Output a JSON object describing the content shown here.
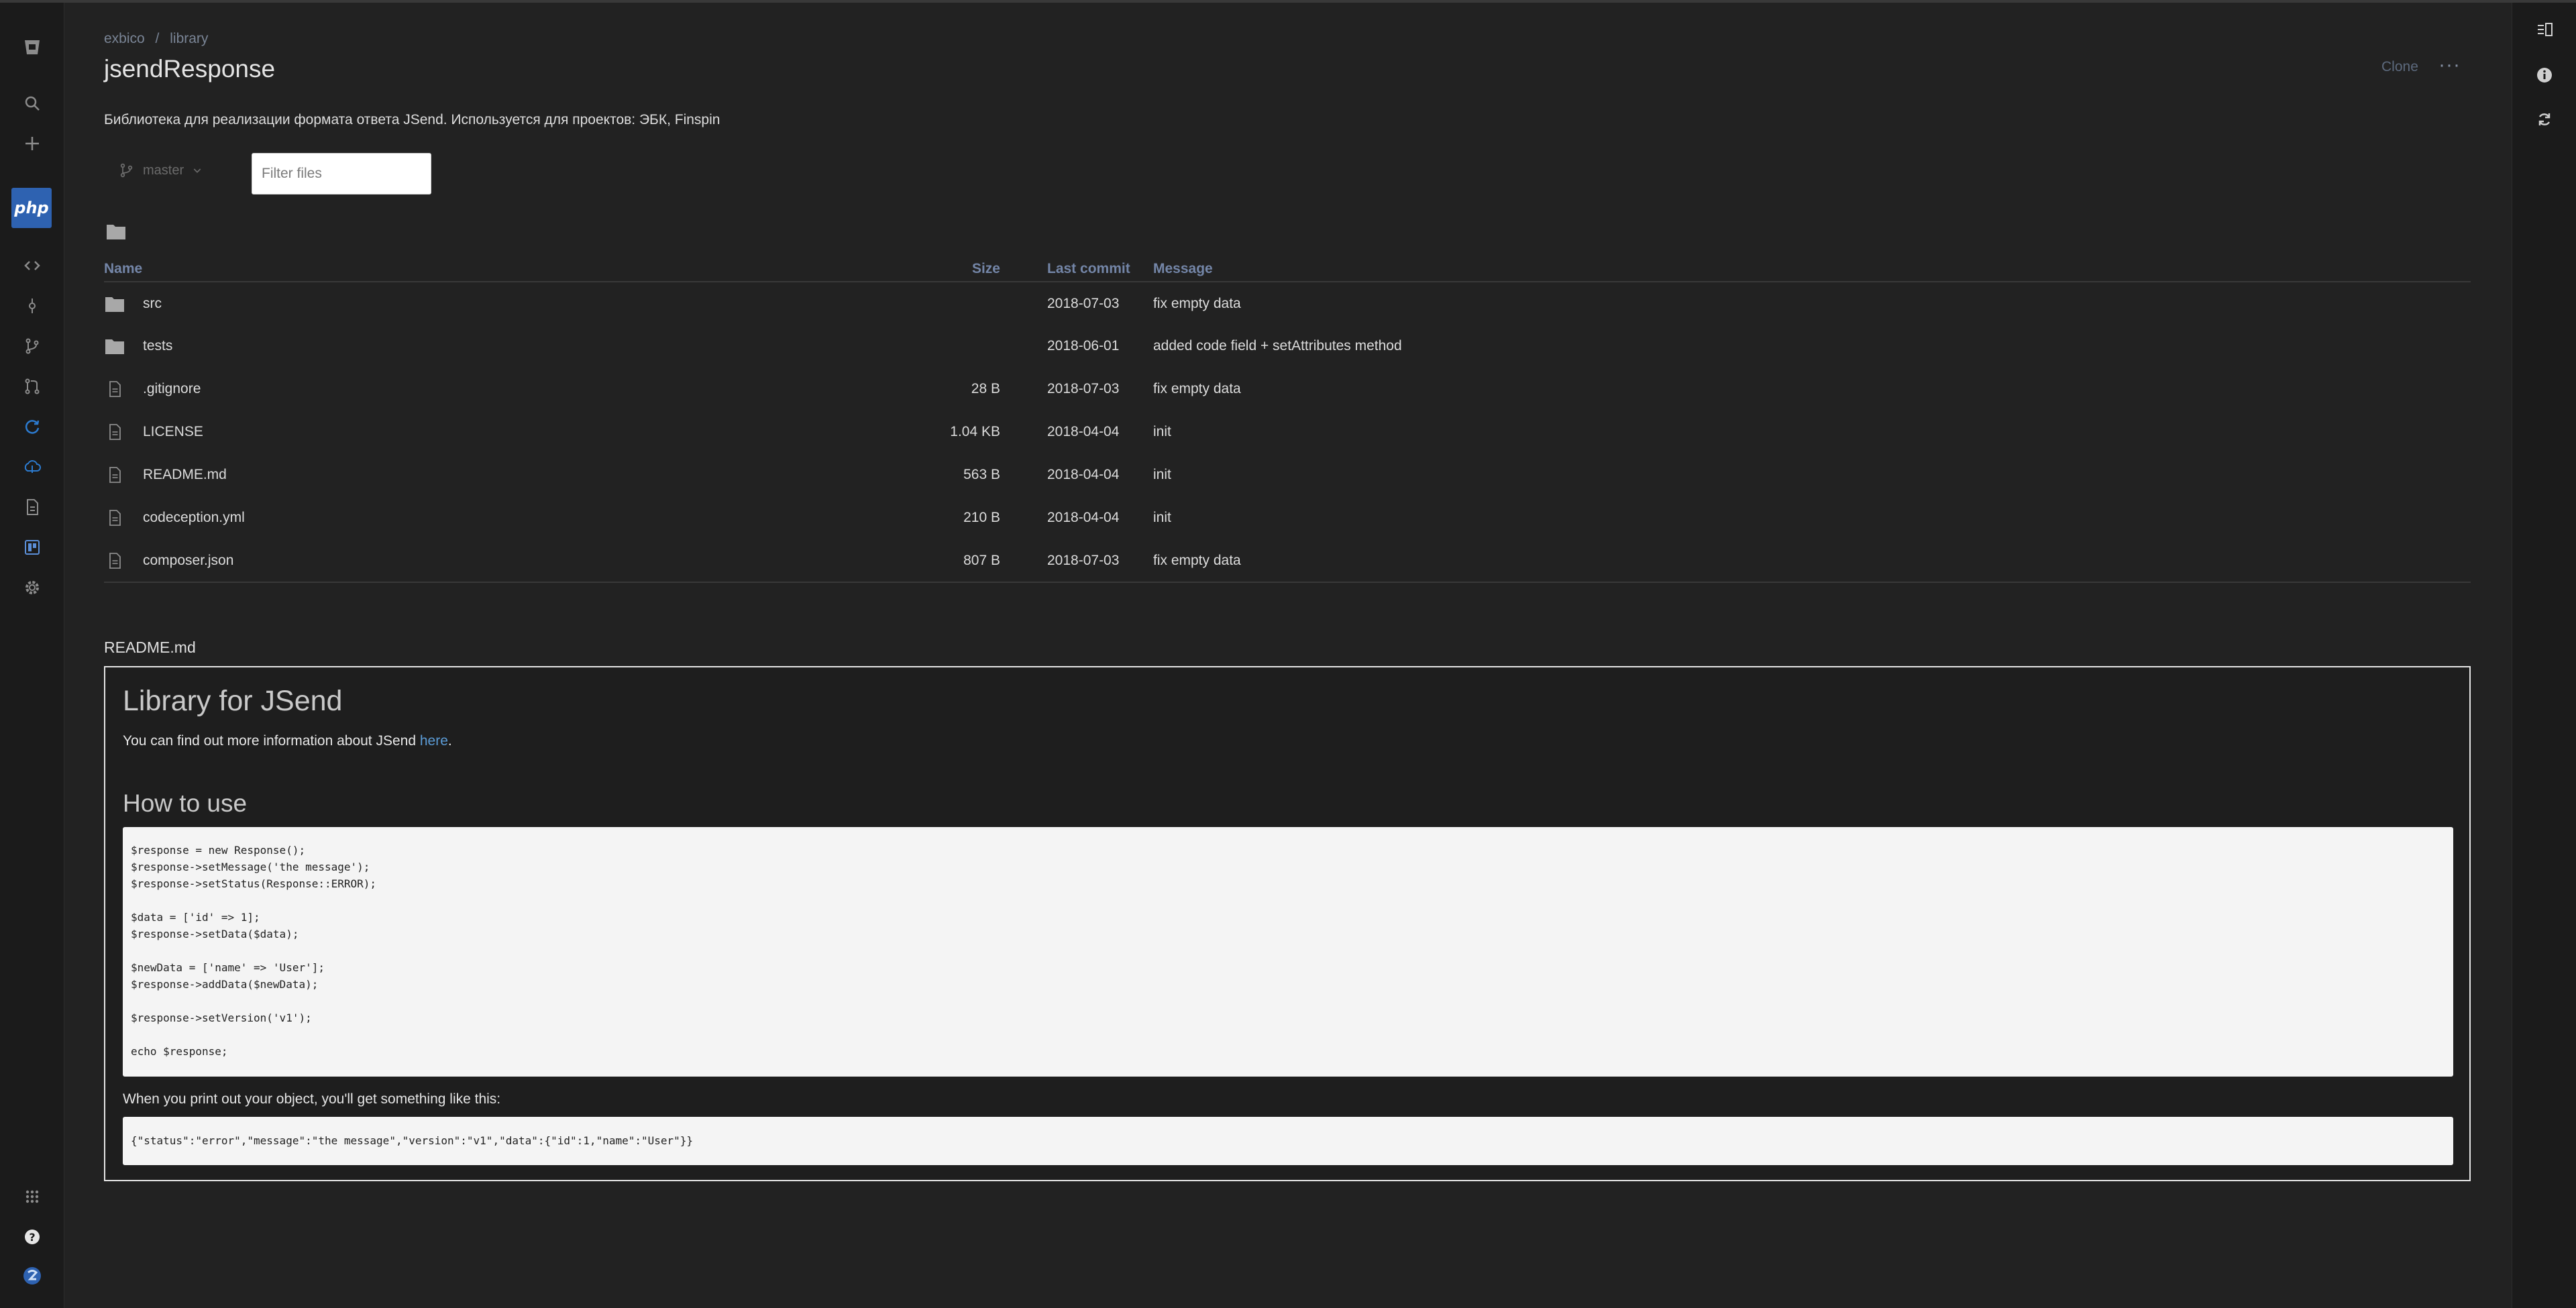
{
  "breadcrumb": {
    "workspace": "exbico",
    "separator": "/",
    "project": "library"
  },
  "repo": {
    "title": "jsendResponse",
    "description": "Библиотека для реализации формата ответа JSend. Используется для проектов: ЭБК, Finspin",
    "clone_label": "Clone",
    "more_label": "···"
  },
  "leftnav": {
    "project_avatar_text": "php",
    "icons": [
      "bucket-logo-icon",
      "search-icon",
      "plus-icon",
      "code-icon",
      "commits-icon",
      "branches-icon",
      "pull-requests-icon",
      "pipelines-icon",
      "deployments-icon",
      "downloads-icon",
      "jira-board-icon",
      "settings-icon",
      "apps-grid-icon",
      "help-icon",
      "user-avatar-icon"
    ]
  },
  "rightrail": {
    "icons": [
      "sidebar-toggle-icon",
      "info-icon",
      "sync-icon"
    ]
  },
  "branch": {
    "name": "master"
  },
  "filter": {
    "placeholder": "Filter files"
  },
  "table": {
    "headers": {
      "name": "Name",
      "size": "Size",
      "last_commit": "Last commit",
      "message": "Message"
    },
    "rows": [
      {
        "type": "folder",
        "name": "src",
        "size": "",
        "last_commit": "2018-07-03",
        "message": "fix empty data"
      },
      {
        "type": "folder",
        "name": "tests",
        "size": "",
        "last_commit": "2018-06-01",
        "message": "added code field + setAttributes method"
      },
      {
        "type": "file",
        "name": ".gitignore",
        "size": "28 B",
        "last_commit": "2018-07-03",
        "message": "fix empty data"
      },
      {
        "type": "file",
        "name": "LICENSE",
        "size": "1.04 KB",
        "last_commit": "2018-04-04",
        "message": "init"
      },
      {
        "type": "file",
        "name": "README.md",
        "size": "563 B",
        "last_commit": "2018-04-04",
        "message": "init"
      },
      {
        "type": "file",
        "name": "codeception.yml",
        "size": "210 B",
        "last_commit": "2018-04-04",
        "message": "init"
      },
      {
        "type": "file",
        "name": "composer.json",
        "size": "807 B",
        "last_commit": "2018-07-03",
        "message": "fix empty data"
      }
    ]
  },
  "readme": {
    "filename": "README.md",
    "title": "Library for JSend",
    "intro_before": "You can find out more information about JSend ",
    "intro_link": "here",
    "intro_after": ".",
    "howto_title": "How to use",
    "code_usage": "$response = new Response();\n$response->setMessage('the message');\n$response->setStatus(Response::ERROR);\n\n$data = ['id' => 1];\n$response->setData($data);\n\n$newData = ['name' => 'User'];\n$response->addData($newData);\n\n$response->setVersion('v1');\n\necho $response;",
    "output_note": "When you print out your object, you'll get something like this:",
    "code_output": "{\"status\":\"error\",\"message\":\"the message\",\"version\":\"v1\",\"data\":{\"id\":1,\"name\":\"User\"}}"
  },
  "colors": {
    "background": "#222222",
    "nav": "#1b1b1b",
    "accent": "#2e62b1",
    "link": "#5b9bd5",
    "header_text": "#7486a8"
  }
}
